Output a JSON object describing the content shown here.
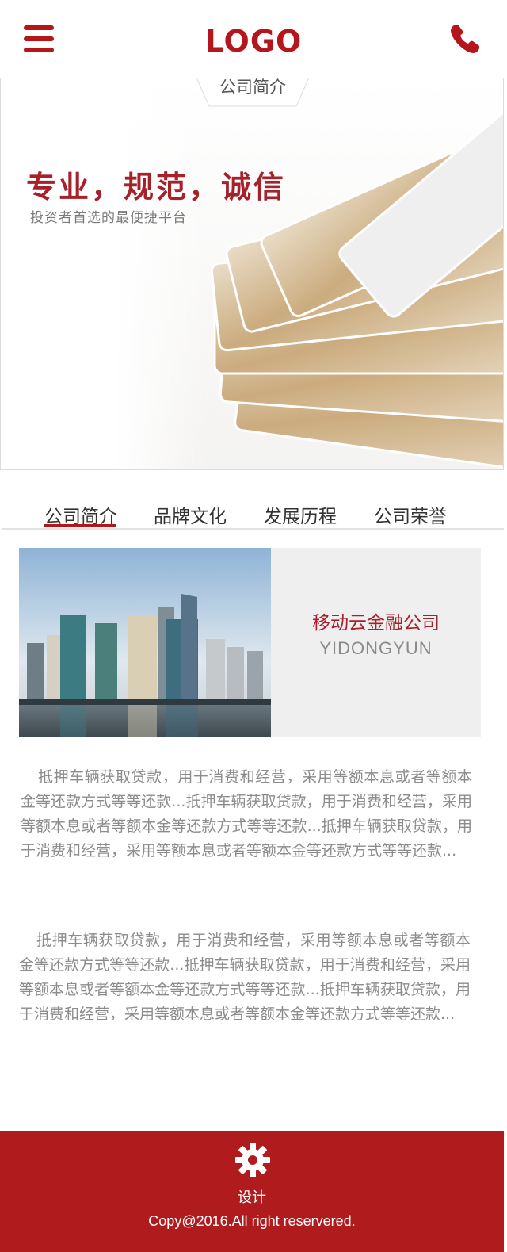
{
  "header": {
    "logo": "LOGO",
    "menu_icon": "menu-icon",
    "phone_icon": "phone-icon"
  },
  "banner": {
    "tab_label": "公司简介",
    "headline": "专业，规范，诚信",
    "subline": "投资者首选的最便捷平台"
  },
  "tabs": [
    {
      "label": "公司简介",
      "active": true
    },
    {
      "label": "品牌文化",
      "active": false
    },
    {
      "label": "发展历程",
      "active": false
    },
    {
      "label": "公司荣誉",
      "active": false
    }
  ],
  "company": {
    "name": "移动云金融公司",
    "name_en": "YIDONGYUN"
  },
  "paragraphs": [
    "抵押车辆获取贷款，用于消费和经营，采用等额本息或者等额本金等还款方式等等还款...抵押车辆获取贷款，用于消费和经营，采用等额本息或者等额本金等还款方式等等还款...抵押车辆获取贷款，用于消费和经营，采用等额本息或者等额本金等还款方式等等还款...",
    "抵押车辆获取贷款，用于消费和经营，采用等额本息或者等额本金等还款方式等等还款...抵押车辆获取贷款，用于消费和经营，采用等额本息或者等额本金等还款方式等等还款...抵押车辆获取贷款，用于消费和经营，采用等额本息或者等额本金等还款方式等等还款..."
  ],
  "footer": {
    "icon": "gear-icon",
    "label": "设计",
    "copyright": "Copy@2016.All right reservered."
  },
  "colors": {
    "brand": "#b5161b",
    "footer_bg": "#b01c1e",
    "text_gray": "#8c8c8c"
  }
}
